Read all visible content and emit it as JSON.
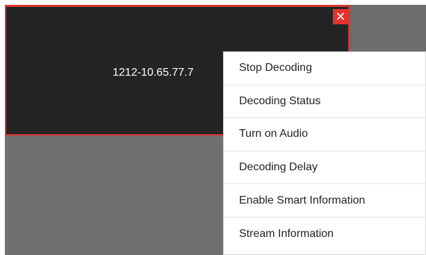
{
  "window": {
    "label": "1212-10.65.77.7",
    "close_glyph": "✕",
    "accent_color": "#d8342c",
    "close_color": "#e5322d"
  },
  "context_menu": {
    "items": [
      {
        "label": "Stop Decoding"
      },
      {
        "label": "Decoding Status"
      },
      {
        "label": "Turn on Audio"
      },
      {
        "label": "Decoding Delay"
      },
      {
        "label": "Enable Smart Information"
      },
      {
        "label": "Stream Information"
      }
    ]
  },
  "icons": {
    "close": "close-icon"
  }
}
